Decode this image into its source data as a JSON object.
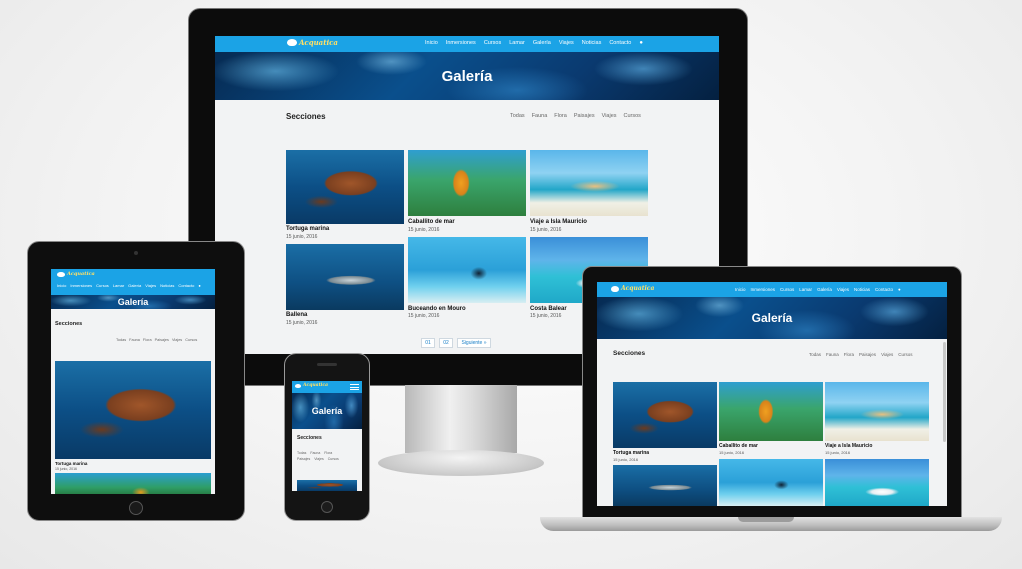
{
  "site": {
    "logo_text": "Acquatica",
    "hero_title": "Galería",
    "sections_title": "Secciones",
    "menu": [
      "Inicio",
      "Inmersiones",
      "Cursos",
      "Lamar",
      "Galería",
      "Viajes",
      "Noticias",
      "Contacto"
    ],
    "filters": [
      "Todas",
      "Fauna",
      "Flora",
      "Paisajes",
      "Viajes",
      "Cursos"
    ],
    "items": [
      {
        "title": "Tortuga marina",
        "date": "15 junio, 2016"
      },
      {
        "title": "Caballito de mar",
        "date": "15 junio, 2016"
      },
      {
        "title": "Viaje a Isla Mauricio",
        "date": "15 junio, 2016"
      },
      {
        "title": "Ballena",
        "date": "15 junio, 2016"
      },
      {
        "title": "Buceando en Mouro",
        "date": "15 junio, 2016"
      },
      {
        "title": "Costa Balear",
        "date": "15 junio, 2016"
      }
    ],
    "pagination": [
      "01",
      "02",
      "Siguiente »"
    ],
    "tablet_item": {
      "title": "Tortuga marina",
      "date": "15 junio, 2016"
    }
  },
  "colors": {
    "nav": "#1ba3e6",
    "logo": "#ffe066",
    "link": "#1b80c8"
  }
}
